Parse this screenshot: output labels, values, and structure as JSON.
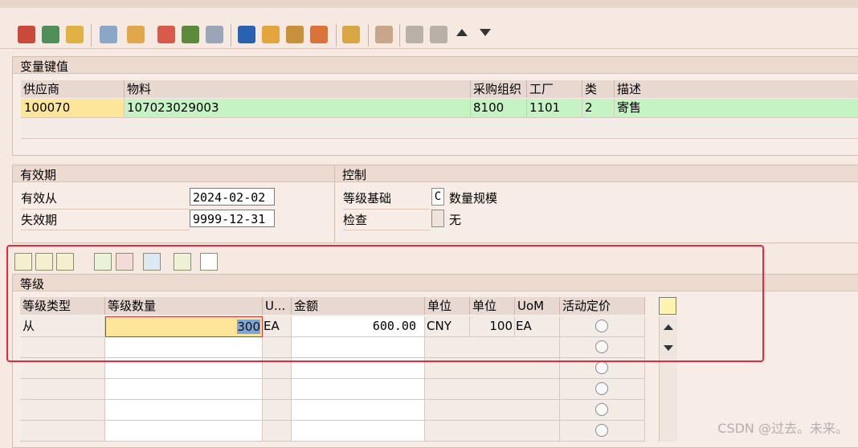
{
  "key_section": {
    "title": "变量键值",
    "headers": [
      "供应商",
      "物料",
      "采购组织",
      "工厂",
      "类",
      "描述"
    ],
    "row": [
      "100070",
      "107023029003",
      "8100",
      "1101",
      "2",
      "寄售"
    ]
  },
  "validity": {
    "title": "有效期",
    "valid_from_label": "有效从",
    "valid_from": "2024-02-02",
    "valid_to_label": "失效期",
    "valid_to": "9999-12-31"
  },
  "control": {
    "title": "控制",
    "scale_basis_label": "等级基础",
    "scale_basis_value": "C",
    "scale_basis_text": "数量规模",
    "check_label": "检查",
    "check_value": "",
    "check_text": "无"
  },
  "scales": {
    "title": "等级",
    "headers": [
      "等级类型",
      "等级数量",
      "U...",
      "金额",
      "单位",
      "单位",
      "UoM",
      "活动定价"
    ],
    "rows": [
      {
        "type": "从",
        "qty": "300",
        "u": "EA",
        "amount": "600.00",
        "currency": "CNY",
        "per": "100",
        "uom": "EA"
      }
    ],
    "empty_rows": 5
  },
  "watermark": "CSDN @过去。未来。",
  "colors": {
    "highlight_yellow": "#fde59a",
    "highlight_green": "#c6f3c4",
    "annotation_red": "#e8283a"
  },
  "icons": [
    "save-icon",
    "find-icon",
    "refresh-icon",
    "copy-icon",
    "transfer-icon",
    "calendar-icon",
    "gift-icon",
    "edit-icon",
    "info-icon",
    "hierarchy-icon",
    "key-icon",
    "discount-icon",
    "landscape-icon",
    "export-icon",
    "prev-record-icon",
    "next-record-icon",
    "arrow-up-icon",
    "arrow-down-icon"
  ]
}
